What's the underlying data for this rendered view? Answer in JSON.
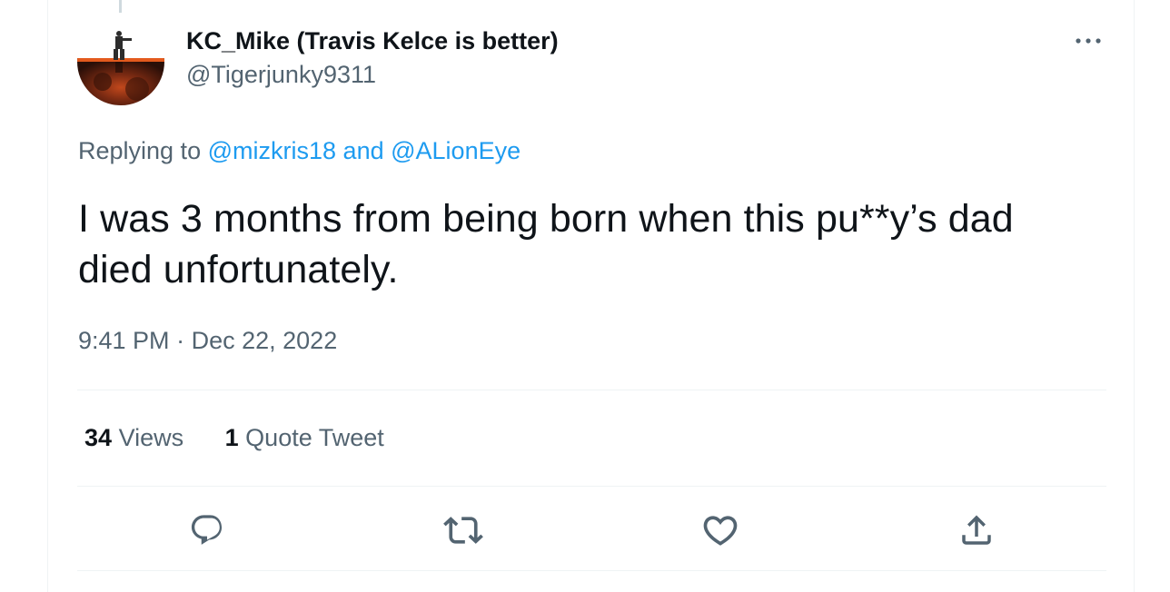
{
  "author": {
    "display_name": "KC_Mike (Travis Kelce is better)",
    "handle": "@Tigerjunky9311"
  },
  "replying": {
    "prefix": "Replying to",
    "mention1": "@mizkris18",
    "conjunction": "and",
    "mention2": "@ALionEye"
  },
  "tweet": {
    "text": "I was 3 months from being born when this pu**y’s dad died unfortunately."
  },
  "meta": {
    "time": "9:41 PM",
    "separator": "·",
    "date": "Dec 22, 2022"
  },
  "stats": {
    "views_count": "34",
    "views_label": "Views",
    "quotes_count": "1",
    "quotes_label": "Quote Tweet"
  },
  "icons": {
    "more": "more-horizontal-icon",
    "reply": "reply-icon",
    "retweet": "retweet-icon",
    "like": "like-icon",
    "share": "share-icon"
  },
  "colors": {
    "text": "#0f1419",
    "secondary": "#536471",
    "accent": "#1d9bf0",
    "divider": "#eff3f4"
  }
}
